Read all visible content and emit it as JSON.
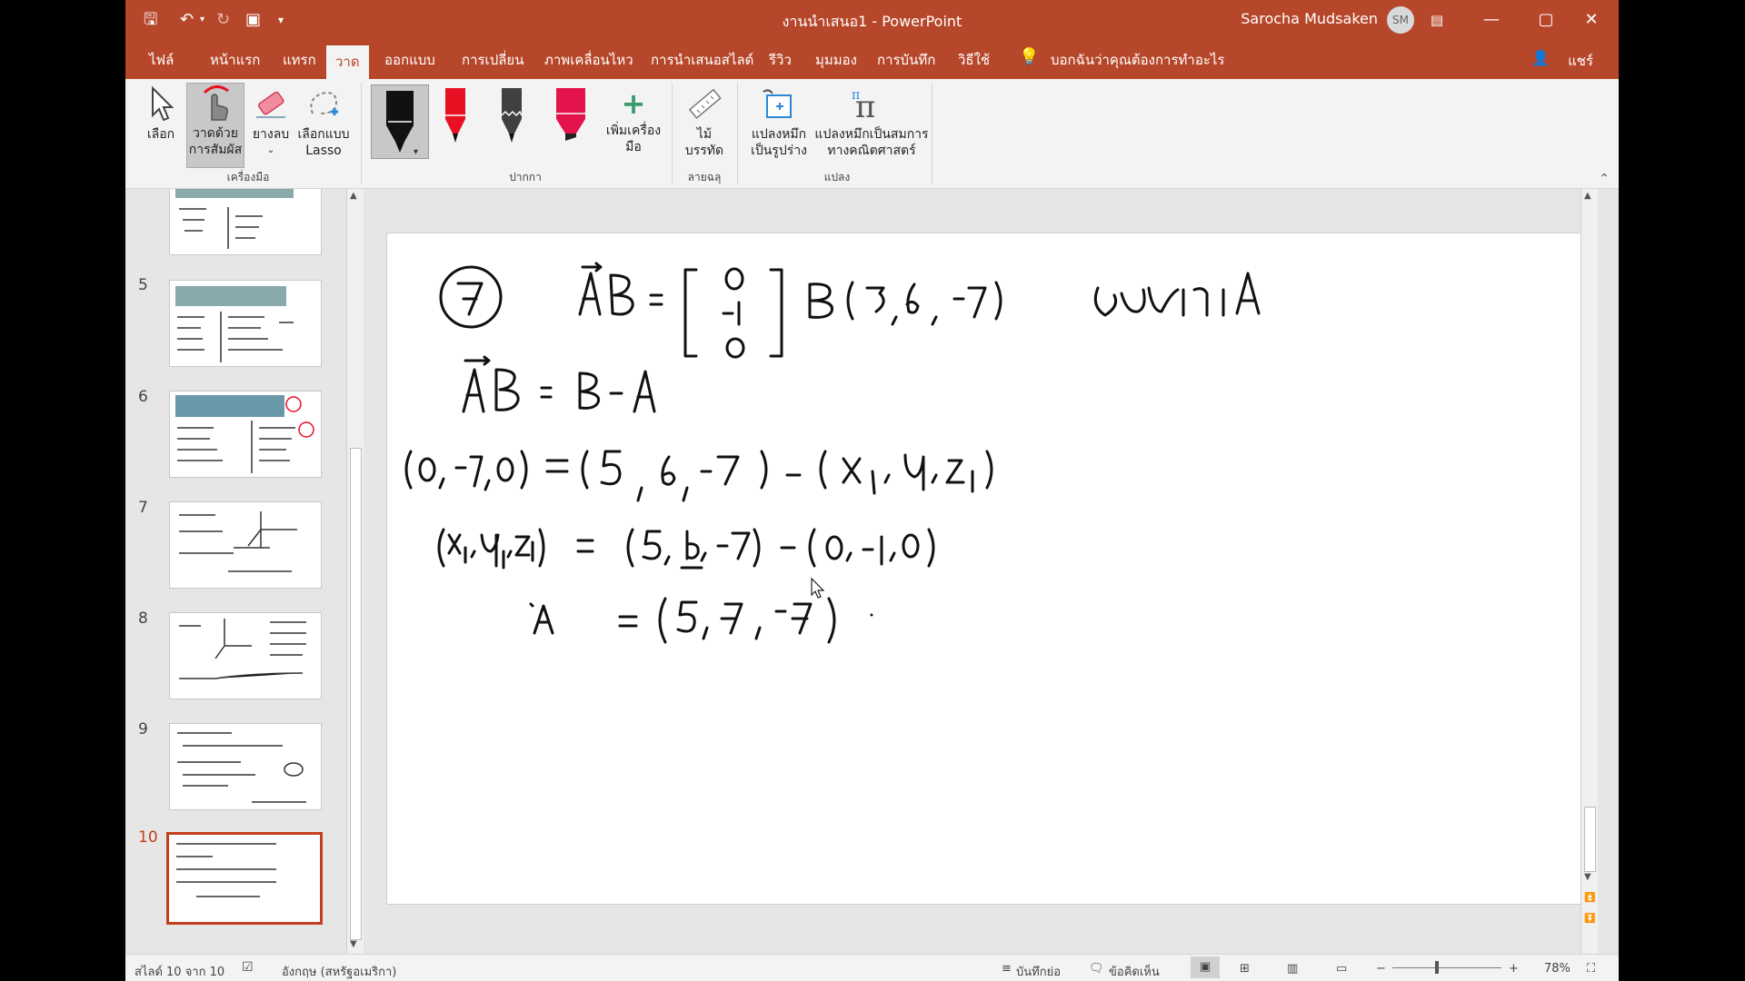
{
  "window": {
    "title": "งานนำเสนอ1 - PowerPoint",
    "user_name": "Sarocha Mudsaken",
    "user_initials": "SM"
  },
  "tabs": [
    {
      "label": "ไฟล์"
    },
    {
      "label": "หน้าแรก"
    },
    {
      "label": "แทรก"
    },
    {
      "label": "วาด",
      "active": true
    },
    {
      "label": "ออกแบบ"
    },
    {
      "label": "การเปลี่ยน"
    },
    {
      "label": "ภาพเคลื่อนไหว"
    },
    {
      "label": "การนำเสนอสไลด์"
    },
    {
      "label": "รีวิว"
    },
    {
      "label": "มุมมอง"
    },
    {
      "label": "การบันทึก"
    },
    {
      "label": "วิธีใช้"
    }
  ],
  "tell_me": "บอกฉันว่าคุณต้องการทำอะไร",
  "share": "แชร์",
  "ribbon": {
    "tools": {
      "select": "เลือก",
      "draw_touch_1": "วาดด้วย",
      "draw_touch_2": "การสัมผัส",
      "eraser": "ยางลบ",
      "lasso_1": "เลือกแบบ",
      "lasso_2": "Lasso",
      "group": "เครื่องมือ"
    },
    "pens": {
      "add_pen_1": "เพิ่มเครื่อง",
      "add_pen_2": "มือ",
      "group": "ปากกา",
      "colors": {
        "black": "#111111",
        "red": "#e81123",
        "gray": "#404040",
        "pink_highlighter": "#e3134c"
      }
    },
    "stencils": {
      "ruler_1": "ไม้",
      "ruler_2": "บรรทัด",
      "group": "ลายฉลุ"
    },
    "convert": {
      "to_shape_1": "แปลงหมึก",
      "to_shape_2": "เป็นรูปร่าง",
      "to_math_1": "แปลงหมึกเป็นสมการ",
      "to_math_2": "ทางคณิตศาสตร์",
      "group": "แปลง"
    }
  },
  "slides": [
    {
      "number": "5"
    },
    {
      "number": "6"
    },
    {
      "number": "7"
    },
    {
      "number": "8"
    },
    {
      "number": "9"
    },
    {
      "number": "10",
      "selected": true
    }
  ],
  "status": {
    "slide_count": "สไลด์ 10 จาก 10",
    "language": "อังกฤษ (สหรัฐอเมริกา)",
    "notes": "บันทึกย่อ",
    "comments": "ข้อคิดเห็น",
    "zoom": "78%"
  },
  "accent_color": "#b7472a"
}
